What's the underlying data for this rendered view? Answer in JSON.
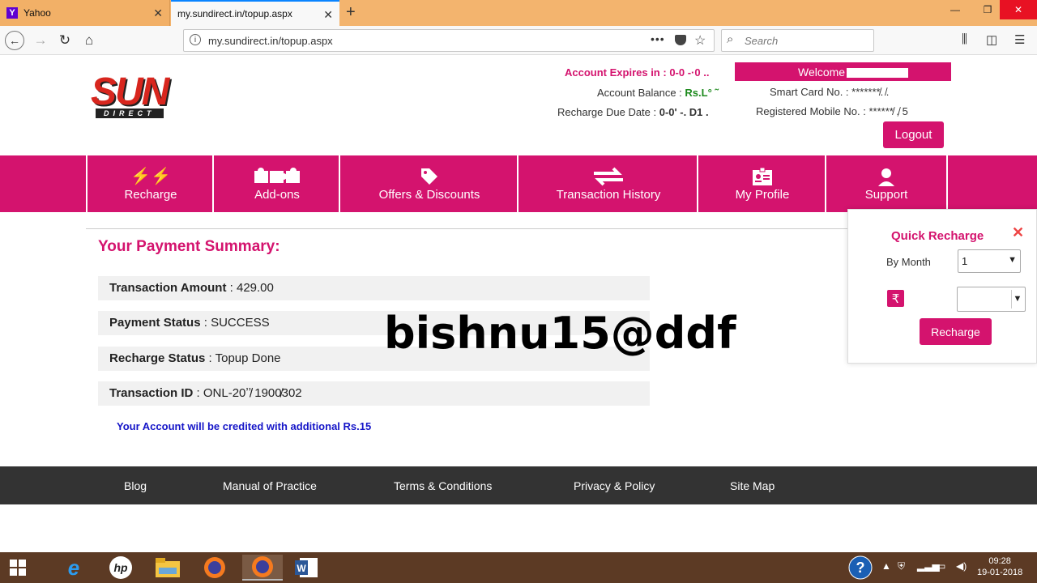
{
  "browser": {
    "tabs": [
      {
        "title": "Yahoo",
        "favicon": "Y"
      },
      {
        "title": "my.sundirect.in/topup.aspx"
      }
    ],
    "url": "my.sundirect.in/topup.aspx",
    "search_placeholder": "Search",
    "url_menu": "•••"
  },
  "header": {
    "logo_text": "SUN",
    "logo_subtext": "DIRECT",
    "account_expires_label": "Account Expires in :",
    "account_expires_value": "0-0  -·0 ..",
    "account_balance_label": "Account Balance :",
    "account_balance_value": "Rs.L° ˜",
    "recharge_due_label": "Recharge Due Date :",
    "recharge_due_value": "0-0' -. D1 .",
    "welcome_label": "Welcome",
    "smart_card_label": "Smart Card No. :",
    "smart_card_value": "*******̸. ̸.",
    "registered_mobile_label": "Registered Mobile No. :",
    "registered_mobile_value": "******̸ ,̸ 5",
    "logout_label": "Logout"
  },
  "nav": [
    {
      "label": "Recharge",
      "icon": "lightning-icon"
    },
    {
      "label": "Add-ons",
      "icon": "puzzle-icon"
    },
    {
      "label": "Offers & Discounts",
      "icon": "tag-icon"
    },
    {
      "label": "Transaction History",
      "icon": "arrows-icon"
    },
    {
      "label": "My Profile",
      "icon": "id-card-icon"
    },
    {
      "label": "Support",
      "icon": "support-agent-icon"
    }
  ],
  "summary": {
    "title": "Your Payment Summary:",
    "rows": [
      {
        "label": "Transaction Amount",
        "value": "429.00"
      },
      {
        "label": "Payment Status",
        "value": "SUCCESS"
      },
      {
        "label": "Recharge Status",
        "value": "Topup Done"
      },
      {
        "label": "Transaction ID",
        "value": "ONL-20ʼʼ̸̸ 1900̸302"
      }
    ],
    "separator": " : ",
    "credited_note": "Your Account will be credited with additional Rs.15"
  },
  "watermark": "bishnu15@ddf",
  "quick_recharge": {
    "title": "Quick Recharge",
    "by_month_label": "By Month",
    "by_month_value": "1",
    "amount_value": "",
    "rupee_symbol": "₹",
    "recharge_button": "Recharge"
  },
  "footer": {
    "links": [
      "Blog",
      "Manual of Practice",
      "Terms & Conditions",
      "Privacy & Policy",
      "Site Map"
    ]
  },
  "taskbar": {
    "time": "09:28",
    "date": "19-01-2018"
  },
  "colors": {
    "brand": "#d4136e",
    "footer": "#333333",
    "taskbar": "#5c3a24",
    "tabbar": "#f3b46e",
    "credited_note": "#1515c8"
  }
}
